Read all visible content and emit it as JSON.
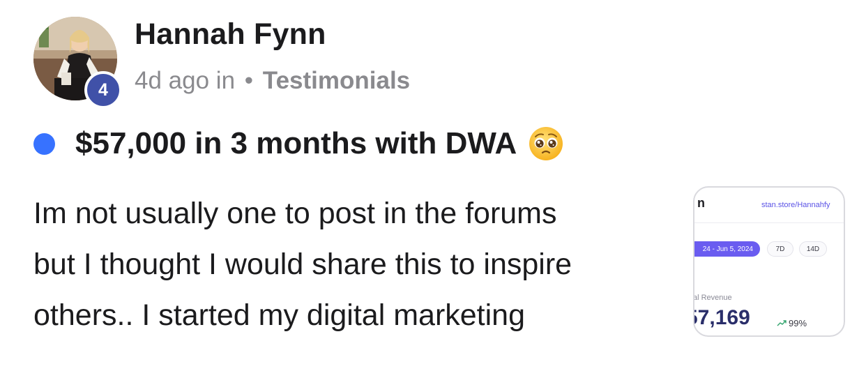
{
  "author": {
    "name": "Hannah Fynn",
    "level": "4",
    "avatar_icon": "profile-photo"
  },
  "meta": {
    "time": "4d ago",
    "in_label": "in",
    "separator": "•",
    "category": "Testimonials"
  },
  "post": {
    "unread_color": "#3772ff",
    "title": "$57,000 in 3 months with DWA",
    "title_emoji": "pleading-face-emoji",
    "body_lines": [
      "Im not usually one to post in the forums",
      "but I thought I would share this to inspire",
      "others.. I started my digital marketing"
    ]
  },
  "attachment": {
    "logo_fragment": "n",
    "store_link": "stan.store/Hannahfy",
    "date_range": "24 - Jun 5, 2024",
    "range_options": [
      "7D",
      "14D"
    ],
    "revenue_label": "al Revenue",
    "revenue_value": "57,169",
    "trend_percent": "99%",
    "trend_icon": "trend-up-icon"
  },
  "colors": {
    "text": "#1b1b1d",
    "muted": "#8a8a8e",
    "badge": "#4051a8",
    "accent": "#3772ff"
  }
}
